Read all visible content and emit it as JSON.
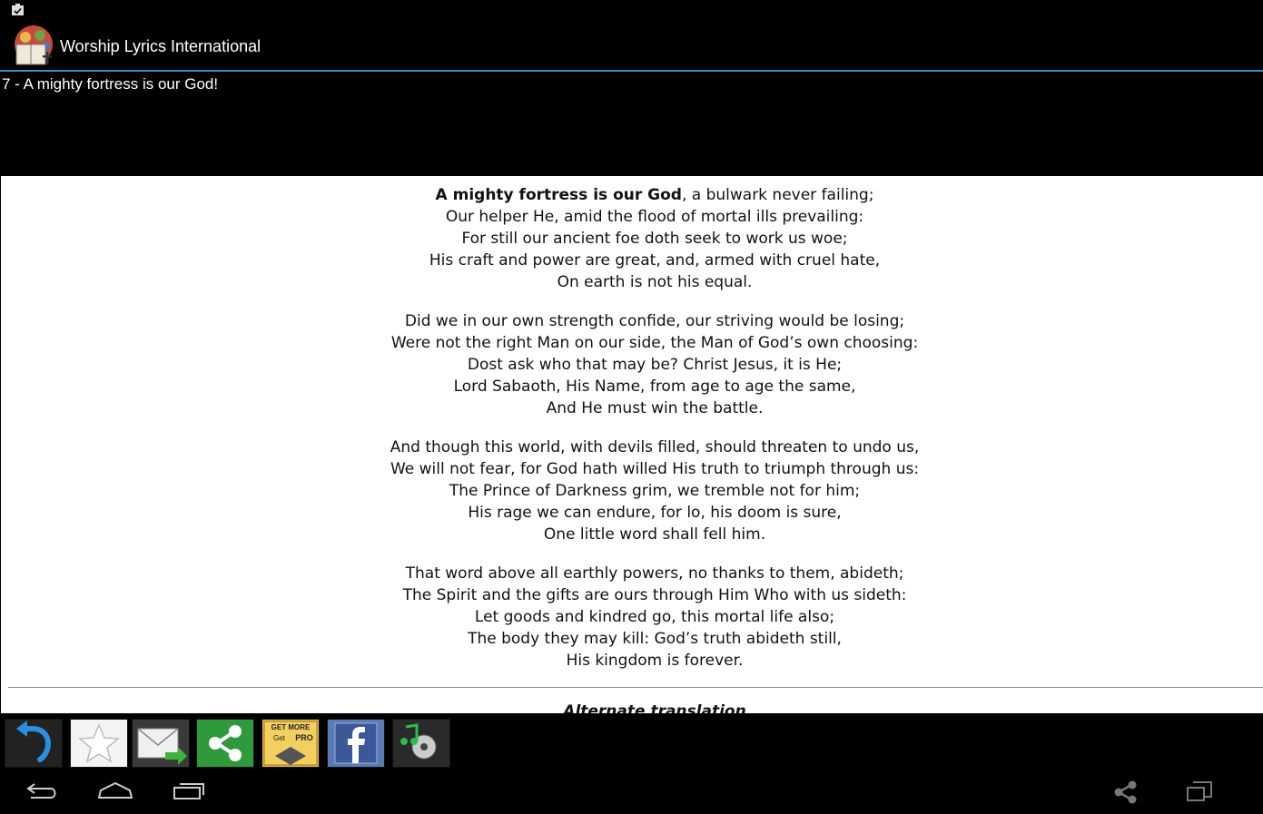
{
  "app": {
    "title": "Worship Lyrics International"
  },
  "song": {
    "header_title": "7 - A mighty fortress is our God!",
    "lead_bold": "A mighty fortress is our God",
    "lead_rest": ", a bulwark never failing;",
    "stanzas": [
      [
        "",
        "Our helper He, amid the flood of mortal ills prevailing:",
        "For still our ancient foe doth seek to work us woe;",
        "His craft and power are great, and, armed with cruel hate,",
        "On earth is not his equal."
      ],
      [
        "Did we in our own strength confide, our striving would be losing;",
        "Were not the right Man on our side, the Man of God’s own choosing:",
        "Dost ask who that may be? Christ Jesus, it is He;",
        "Lord Sabaoth, His Name, from age to age the same,",
        "And He must win the battle."
      ],
      [
        "And though this world, with devils filled, should threaten to undo us,",
        "We will not fear, for God hath willed His truth to triumph through us:",
        "The Prince of Darkness grim, we tremble not for him;",
        "His rage we can endure, for lo, his doom is sure,",
        "One little word shall fell him."
      ],
      [
        "That word above all earthly powers, no thanks to them, abideth;",
        "The Spirit and the gifts are ours through Him Who with us sideth:",
        "Let goods and kindred go, this mortal life also;",
        "The body they may kill: God’s truth abideth still,",
        "His kingdom is forever."
      ]
    ],
    "alt_heading": "Alternate translation"
  },
  "toolbar": {
    "pro_line1": "GET MORE",
    "pro_line2": "Get",
    "pro_line3": "PRO",
    "icons": [
      "back-arrow-icon",
      "star-icon",
      "email-forward-icon",
      "share-icon",
      "get-pro-icon",
      "facebook-icon",
      "music-icon"
    ]
  },
  "nav": {
    "icons": [
      "back-icon",
      "home-icon",
      "recents-icon",
      "share-icon",
      "screen-mode-icon"
    ]
  },
  "colors": {
    "accent_line": "#3f8fc0",
    "share_green": "#2e9a3c",
    "facebook_blue": "#3b5998"
  }
}
